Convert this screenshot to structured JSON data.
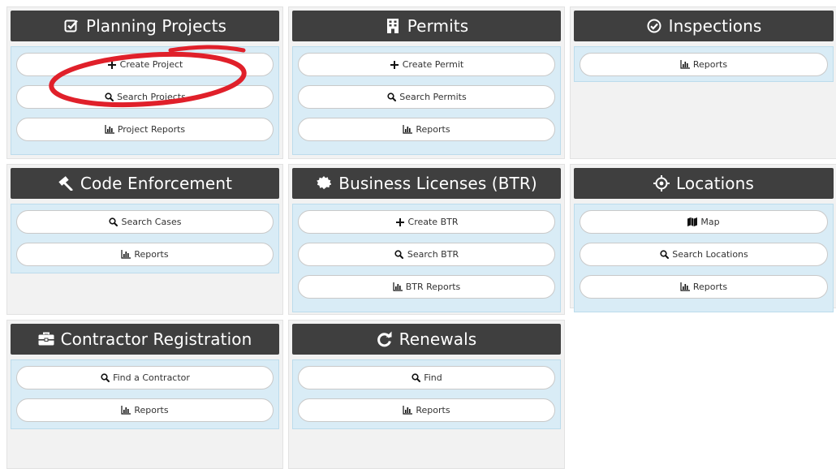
{
  "modules": [
    {
      "title": "Planning Projects",
      "icon": "checkbox-icon",
      "buttons": [
        {
          "label": "Create Project",
          "icon": "plus-icon"
        },
        {
          "label": "Search Projects",
          "icon": "search-icon"
        },
        {
          "label": "Project Reports",
          "icon": "bar-chart-icon"
        }
      ]
    },
    {
      "title": "Permits",
      "icon": "building-icon",
      "buttons": [
        {
          "label": "Create Permit",
          "icon": "plus-icon"
        },
        {
          "label": "Search Permits",
          "icon": "search-icon"
        },
        {
          "label": "Reports",
          "icon": "bar-chart-icon"
        }
      ]
    },
    {
      "title": "Inspections",
      "icon": "check-circle-icon",
      "buttons": [
        {
          "label": "Reports",
          "icon": "bar-chart-icon"
        }
      ]
    },
    {
      "title": "Code Enforcement",
      "icon": "gavel-icon",
      "buttons": [
        {
          "label": "Search Cases",
          "icon": "search-icon"
        },
        {
          "label": "Reports",
          "icon": "bar-chart-icon"
        }
      ]
    },
    {
      "title": "Business Licenses (BTR)",
      "icon": "certificate-icon",
      "buttons": [
        {
          "label": "Create BTR",
          "icon": "plus-icon"
        },
        {
          "label": "Search BTR",
          "icon": "search-icon"
        },
        {
          "label": "BTR Reports",
          "icon": "bar-chart-icon"
        }
      ]
    },
    {
      "title": "Locations",
      "icon": "crosshairs-icon",
      "buttons": [
        {
          "label": "Map",
          "icon": "map-icon"
        },
        {
          "label": "Search Locations",
          "icon": "search-icon"
        },
        {
          "label": "Reports",
          "icon": "bar-chart-icon"
        }
      ]
    },
    {
      "title": "Contractor Registration",
      "icon": "briefcase-icon",
      "buttons": [
        {
          "label": "Find a Contractor",
          "icon": "search-icon"
        },
        {
          "label": "Reports",
          "icon": "bar-chart-icon"
        }
      ]
    },
    {
      "title": "Renewals",
      "icon": "refresh-icon",
      "buttons": [
        {
          "label": "Find",
          "icon": "search-icon"
        },
        {
          "label": "Reports",
          "icon": "bar-chart-icon"
        }
      ]
    }
  ],
  "colors": {
    "header_bg": "#3f3f3f",
    "panel_bg": "#d9ecf6",
    "module_bg": "#f2f2f2",
    "annotation": "#e0202a"
  }
}
